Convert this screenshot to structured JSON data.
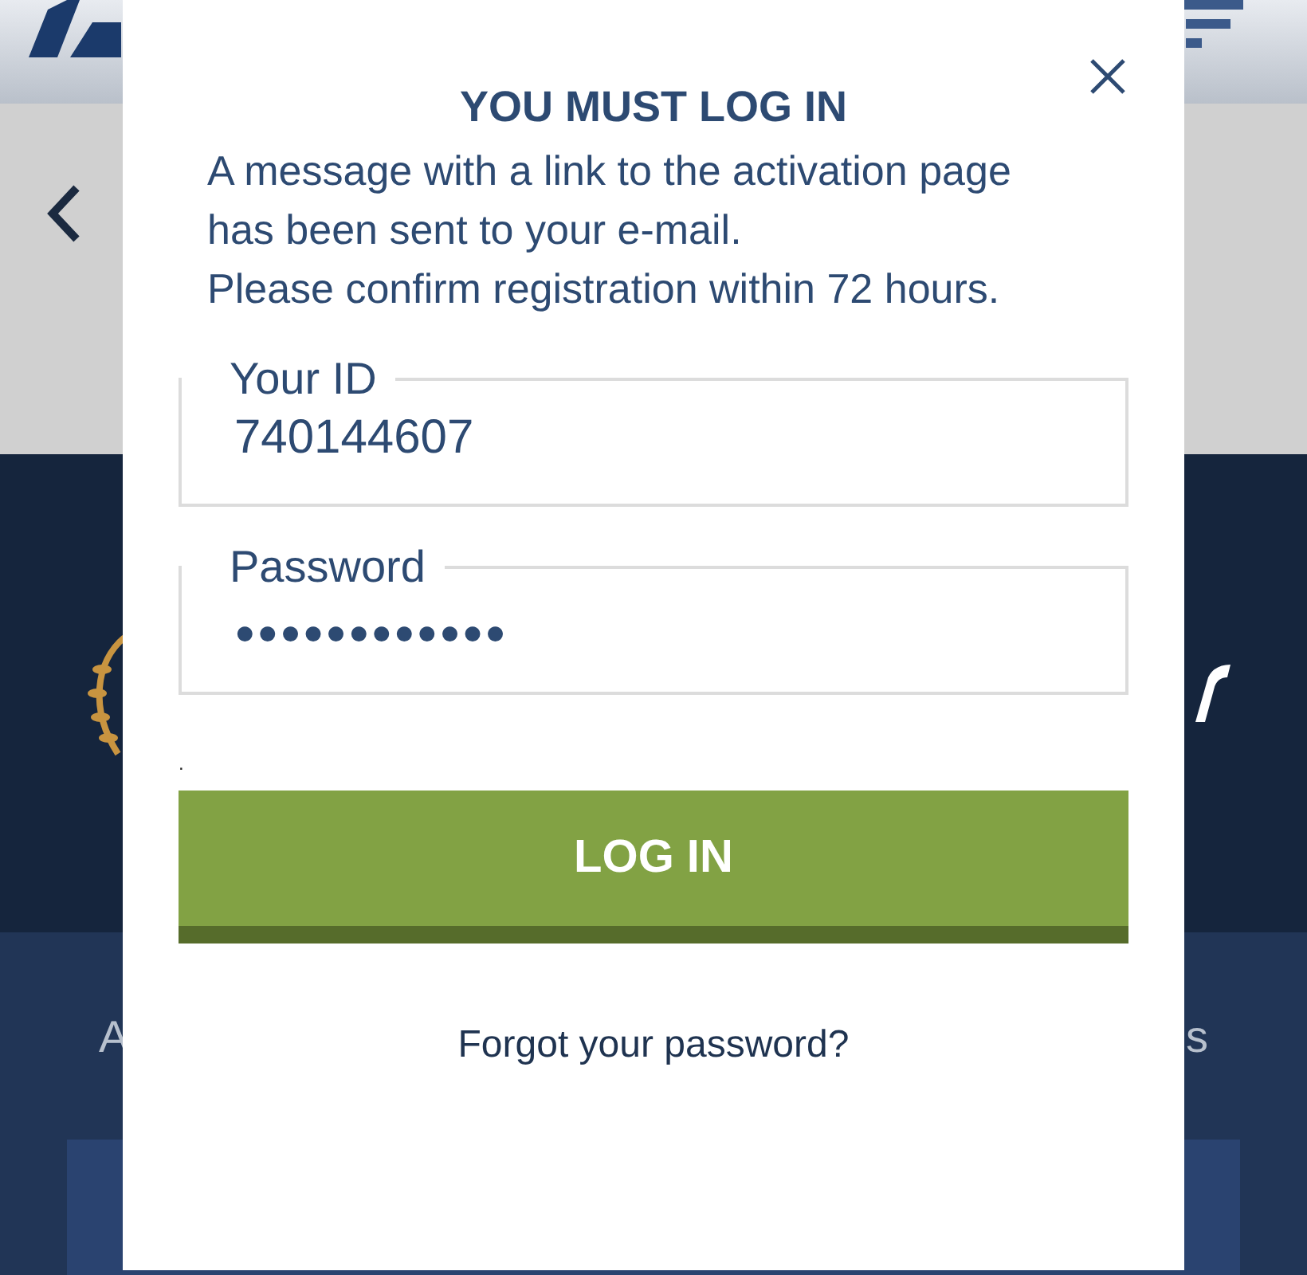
{
  "background": {
    "left_text": "A",
    "right_text": "s"
  },
  "dialog": {
    "title": "YOU MUST LOG IN",
    "message": [
      "A message with a link to the activation page",
      "has been sent to your e-mail.",
      "Please confirm registration within 72 hours."
    ],
    "fields": [
      {
        "label": "Your ID",
        "value": "740144607",
        "kind": "text"
      },
      {
        "label": "Password",
        "value": "●●●●●●●●●●●●",
        "kind": "password"
      }
    ],
    "note": ".",
    "button": "LOG IN",
    "link": "Forgot your password?"
  }
}
